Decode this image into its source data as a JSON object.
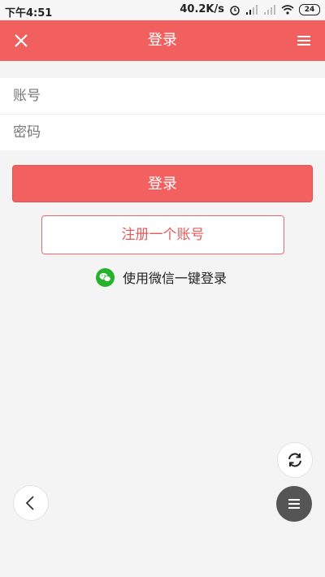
{
  "status_bar": {
    "time": "下午4:51",
    "network_speed": "40.2K/s",
    "battery": "24"
  },
  "header": {
    "title": "登录",
    "close_icon": "close-icon",
    "menu_icon": "hamburger-icon",
    "background": "#f15f5f"
  },
  "form": {
    "account_placeholder": "账号",
    "password_placeholder": "密码"
  },
  "buttons": {
    "login_label": "登录",
    "register_label": "注册一个账号",
    "wechat_label": "使用微信一键登录"
  },
  "colors": {
    "accent": "#f15f5f",
    "wechat": "#26b22b"
  },
  "floating": {
    "refresh_icon": "refresh-icon",
    "back_icon": "chevron-left-icon",
    "menu_icon": "hamburger-icon"
  }
}
